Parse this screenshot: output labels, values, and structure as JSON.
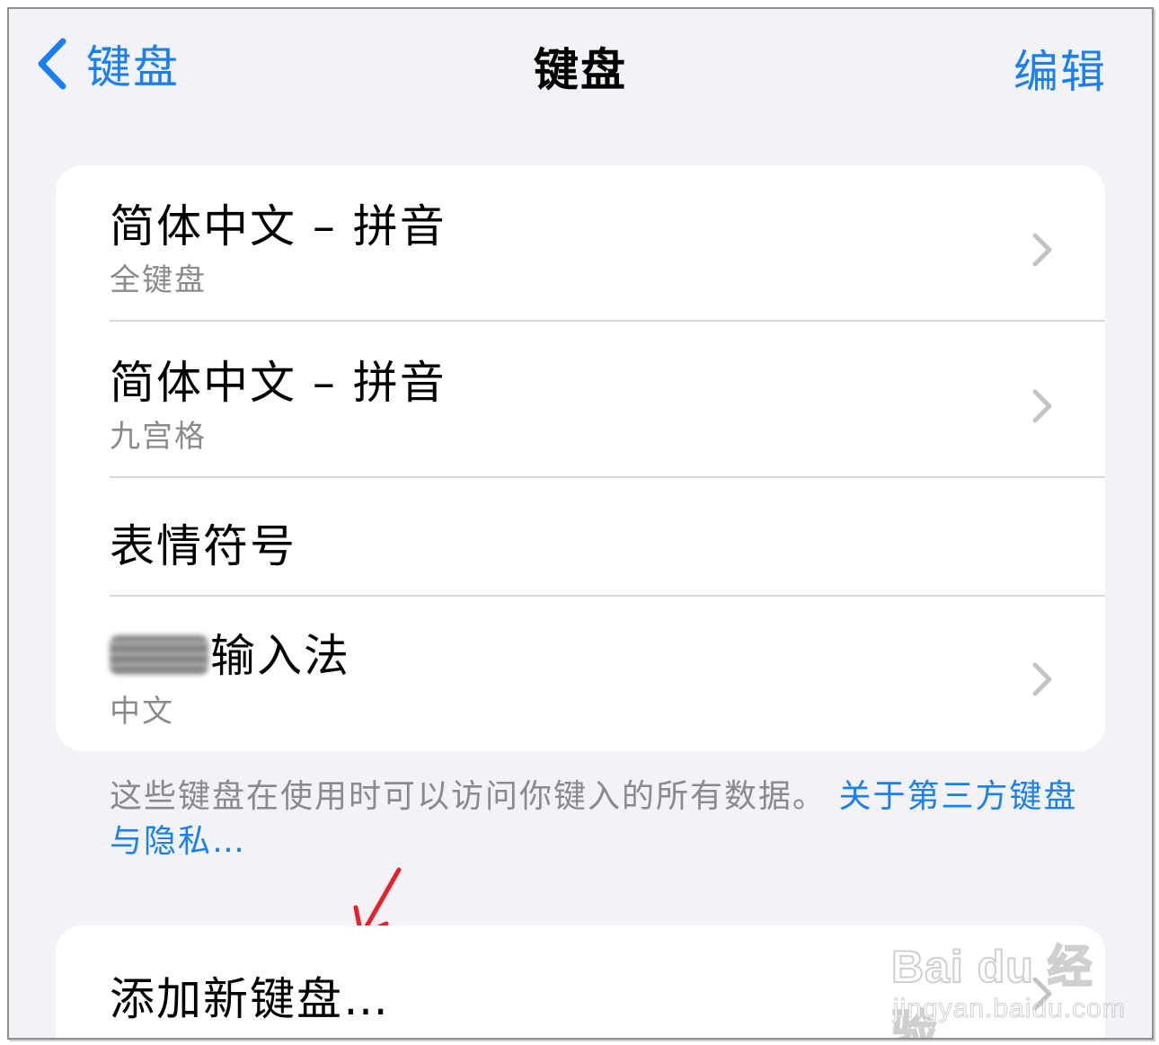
{
  "nav": {
    "back_label": "键盘",
    "title": "键盘",
    "edit_label": "编辑"
  },
  "keyboards": [
    {
      "title": "简体中文 – 拼音",
      "subtitle": "全键盘",
      "has_chevron": true
    },
    {
      "title": "简体中文 – 拼音",
      "subtitle": "九宫格",
      "has_chevron": true
    },
    {
      "title": "表情符号",
      "subtitle": "",
      "has_chevron": false
    },
    {
      "title": "输入法",
      "subtitle": "中文",
      "has_chevron": true,
      "name_redacted": true
    }
  ],
  "footnote": {
    "text": "这些键盘在使用时可以访问你键入的所有数据。",
    "link": "关于第三方键盘与隐私…"
  },
  "add_keyboard": {
    "label": "添加新键盘…"
  },
  "watermark": {
    "brand": "Bai du 经验",
    "url": "jingyan.baidu.com"
  },
  "colors": {
    "accent": "#1a7ff2",
    "background": "#f2f2f7",
    "card": "#ffffff",
    "secondary_text": "#8a8a8e",
    "annotation": "#e8202a"
  },
  "icons": {
    "back": "chevron-left-icon",
    "disclosure": "chevron-right-icon",
    "annotation": "red-arrow-icon"
  }
}
